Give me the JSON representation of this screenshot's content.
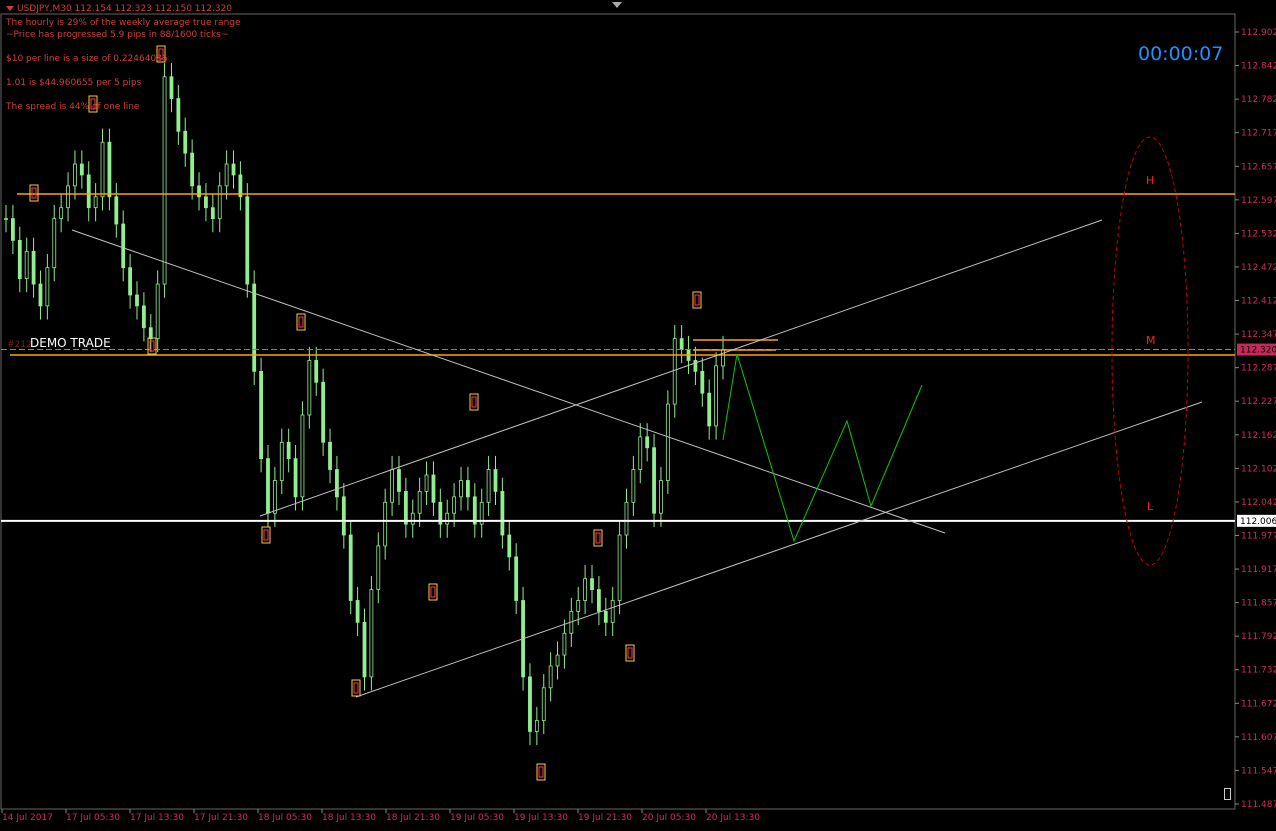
{
  "header": {
    "symbol_line": "USDJPY,M30  112.154 112.323 112.150 112.320",
    "info_lines": [
      "The hourly is 29% of the weekly average true range",
      "~Price has progressed  5.9  pips in 88/1600 ticks~",
      "$10 per line is a size of 0.22464086",
      "1.01 is $44.960655 per 5 pips",
      "The spread is 44% of one line"
    ]
  },
  "timer": "00:00:07",
  "demo_label": "DEMO TRADE",
  "order_id": "#212",
  "zones": {
    "high": "H",
    "mid": "M",
    "low": "L"
  },
  "colors": {
    "background": "#000000",
    "axis_text": "#d6285a",
    "candle": "#90ee90",
    "orange_line": "#ffa500",
    "white_line": "#ffffff",
    "forecast": "#00cc00",
    "trendline": "#c0c0c0",
    "ellipse": "#cc0000",
    "timer": "#1e90ff"
  },
  "chart_data": {
    "type": "line",
    "symbol": "USDJPY",
    "timeframe": "M30",
    "price_axis": {
      "ticks": [
        "112.902",
        "112.842",
        "112.782",
        "112.717",
        "112.657",
        "112.597",
        "112.532",
        "112.472",
        "112.412",
        "112.347",
        "112.287",
        "112.227",
        "112.162",
        "112.102",
        "112.042",
        "111.977",
        "111.917",
        "111.857",
        "111.792",
        "111.732",
        "111.672",
        "111.607",
        "111.547",
        "111.487"
      ],
      "current_price_label": "112.320",
      "white_line_label": "112.006",
      "ylim": [
        111.487,
        112.902
      ]
    },
    "time_axis": {
      "ticks": [
        "14 Jul 2017",
        "17 Jul 05:30",
        "17 Jul 13:30",
        "17 Jul 21:30",
        "18 Jul 05:30",
        "18 Jul 13:30",
        "18 Jul 21:30",
        "19 Jul 05:30",
        "19 Jul 13:30",
        "19 Jul 21:30",
        "20 Jul 05:30",
        "20 Jul 13:30"
      ]
    },
    "levels": {
      "orange_upper": 112.605,
      "orange_lower": 112.31,
      "white": 112.006,
      "current": 112.32
    },
    "close_series": [
      112.56,
      112.52,
      112.45,
      112.5,
      112.44,
      112.4,
      112.47,
      112.56,
      112.58,
      112.62,
      112.66,
      112.64,
      112.58,
      112.6,
      112.7,
      112.6,
      112.55,
      112.47,
      112.42,
      112.4,
      112.36,
      112.34,
      112.44,
      112.82,
      112.78,
      112.72,
      112.68,
      112.62,
      112.6,
      112.58,
      112.56,
      112.62,
      112.66,
      112.64,
      112.6,
      112.44,
      112.28,
      112.12,
      112.02,
      112.08,
      112.15,
      112.12,
      112.05,
      112.2,
      112.3,
      112.26,
      112.15,
      112.1,
      112.05,
      111.98,
      111.86,
      111.82,
      111.72,
      111.88,
      111.96,
      112.04,
      112.1,
      112.06,
      112.0,
      112.02,
      112.06,
      112.09,
      112.04,
      112.0,
      112.02,
      112.05,
      112.08,
      112.05,
      112.0,
      112.04,
      112.1,
      112.06,
      111.98,
      111.94,
      111.86,
      111.72,
      111.62,
      111.64,
      111.7,
      111.74,
      111.76,
      111.8,
      111.84,
      111.86,
      111.9,
      111.88,
      111.84,
      111.82,
      111.86,
      111.98,
      112.04,
      112.1,
      112.16,
      112.14,
      112.02,
      112.08,
      112.22,
      112.34,
      112.32,
      112.3,
      112.28,
      112.24,
      112.18,
      112.29,
      112.32
    ],
    "forecast": {
      "x": [
        "20 Jul 13:30",
        "+2",
        "+4",
        "+6",
        "+8",
        "+10",
        "+12",
        "+14"
      ],
      "y": [
        112.32,
        112.1,
        111.98,
        112.07,
        112.17,
        112.04,
        112.24,
        null
      ]
    }
  }
}
